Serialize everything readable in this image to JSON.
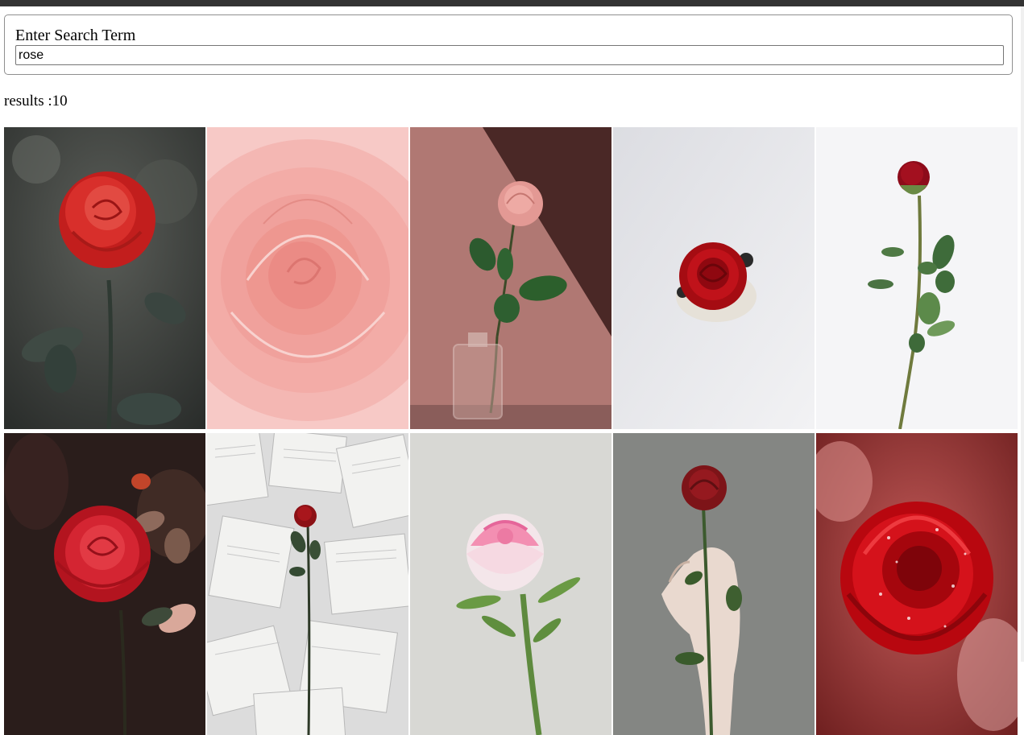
{
  "search": {
    "label": "Enter Search Term",
    "value": "rose"
  },
  "results": {
    "text": "results :10"
  },
  "images": [
    {
      "name": "red rose with dew on dark background",
      "accent": "#d62d2a"
    },
    {
      "name": "pink rose petals close-up",
      "accent": "#f4a8a4"
    },
    {
      "name": "pink rose in glass vase",
      "accent": "#e8938e"
    },
    {
      "name": "red rose head on white",
      "accent": "#b50c12"
    },
    {
      "name": "long stem red rose on white",
      "accent": "#9c0d1d"
    },
    {
      "name": "red rose in dark garden",
      "accent": "#dc2a34"
    },
    {
      "name": "red rose on book pages",
      "accent": "#8f1118"
    },
    {
      "name": "pink and white rose",
      "accent": "#ee6f98"
    },
    {
      "name": "hand holding red rose",
      "accent": "#8f1d1d"
    },
    {
      "name": "red rose with water drops",
      "accent": "#e0131a"
    }
  ]
}
